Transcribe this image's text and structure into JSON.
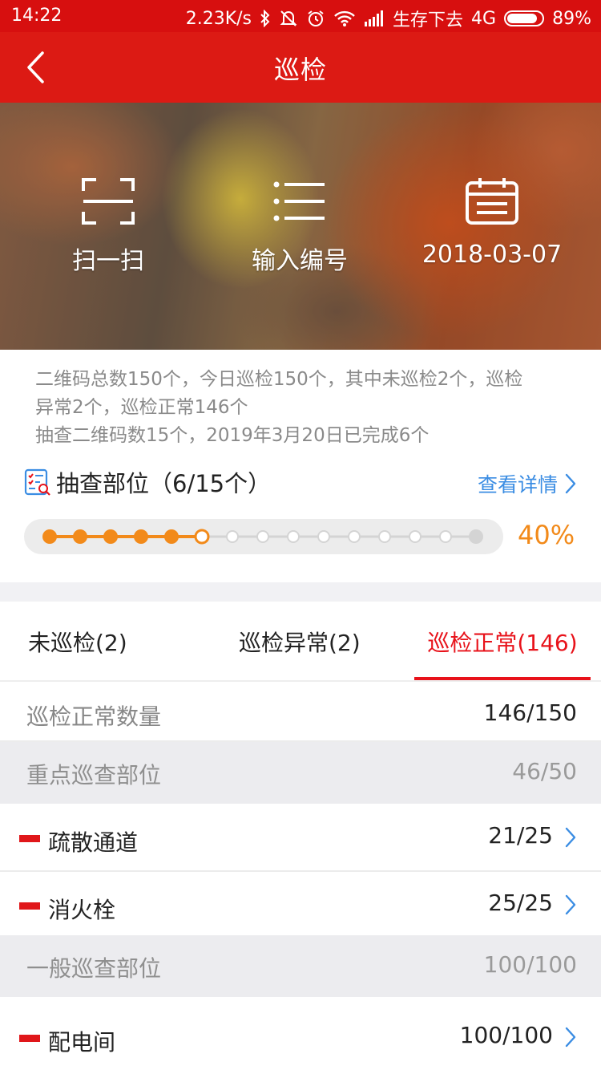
{
  "status_bar": {
    "time": "14:22",
    "speed": "2.23K/s",
    "carrier": "生存下去",
    "network": "4G",
    "battery": "89%",
    "battery_level": 0.89,
    "icons": [
      "bluetooth-icon",
      "mute-icon",
      "alarm-icon",
      "wifi-icon",
      "signal-icon",
      "battery-icon"
    ]
  },
  "nav": {
    "title": "巡检",
    "back_icon": "chevron-left-icon"
  },
  "actions": [
    {
      "label": "扫一扫",
      "icon": "scan-icon"
    },
    {
      "label": "输入编号",
      "icon": "list-icon"
    },
    {
      "label": "2018-03-07",
      "icon": "calendar-icon"
    }
  ],
  "summary": {
    "line1": "二维码总数150个，今日巡检150个，其中未巡检2个，巡检",
    "line2": "异常2个，巡检正常146个",
    "line3": "抽查二维码数15个，2019年3月20日已完成6个"
  },
  "spot_check": {
    "title": "抽查部位（6/15个）",
    "link": "查看详情",
    "percent": "40%",
    "completed": 6,
    "total": 15,
    "accent": "#f28a1a"
  },
  "tabs": [
    {
      "label": "未巡检(2)"
    },
    {
      "label": "巡检异常(2)"
    },
    {
      "label": "巡检正常(146)",
      "active": true
    }
  ],
  "total_row": {
    "label": "巡检正常数量",
    "value": "146/150"
  },
  "sections": [
    {
      "label": "重点巡查部位",
      "value": "46/50",
      "items": [
        {
          "label": "疏散通道",
          "value": "21/25"
        },
        {
          "label": "消火栓",
          "value": "25/25"
        }
      ]
    },
    {
      "label": "一般巡查部位",
      "value": "100/100",
      "items": [
        {
          "label": "配电间",
          "value": "100/100"
        }
      ]
    }
  ],
  "colors": {
    "brand_red": "#dc1a14",
    "active_tab": "#e8121a",
    "link_blue": "#3b8de3",
    "progress_orange": "#f28a1a"
  }
}
